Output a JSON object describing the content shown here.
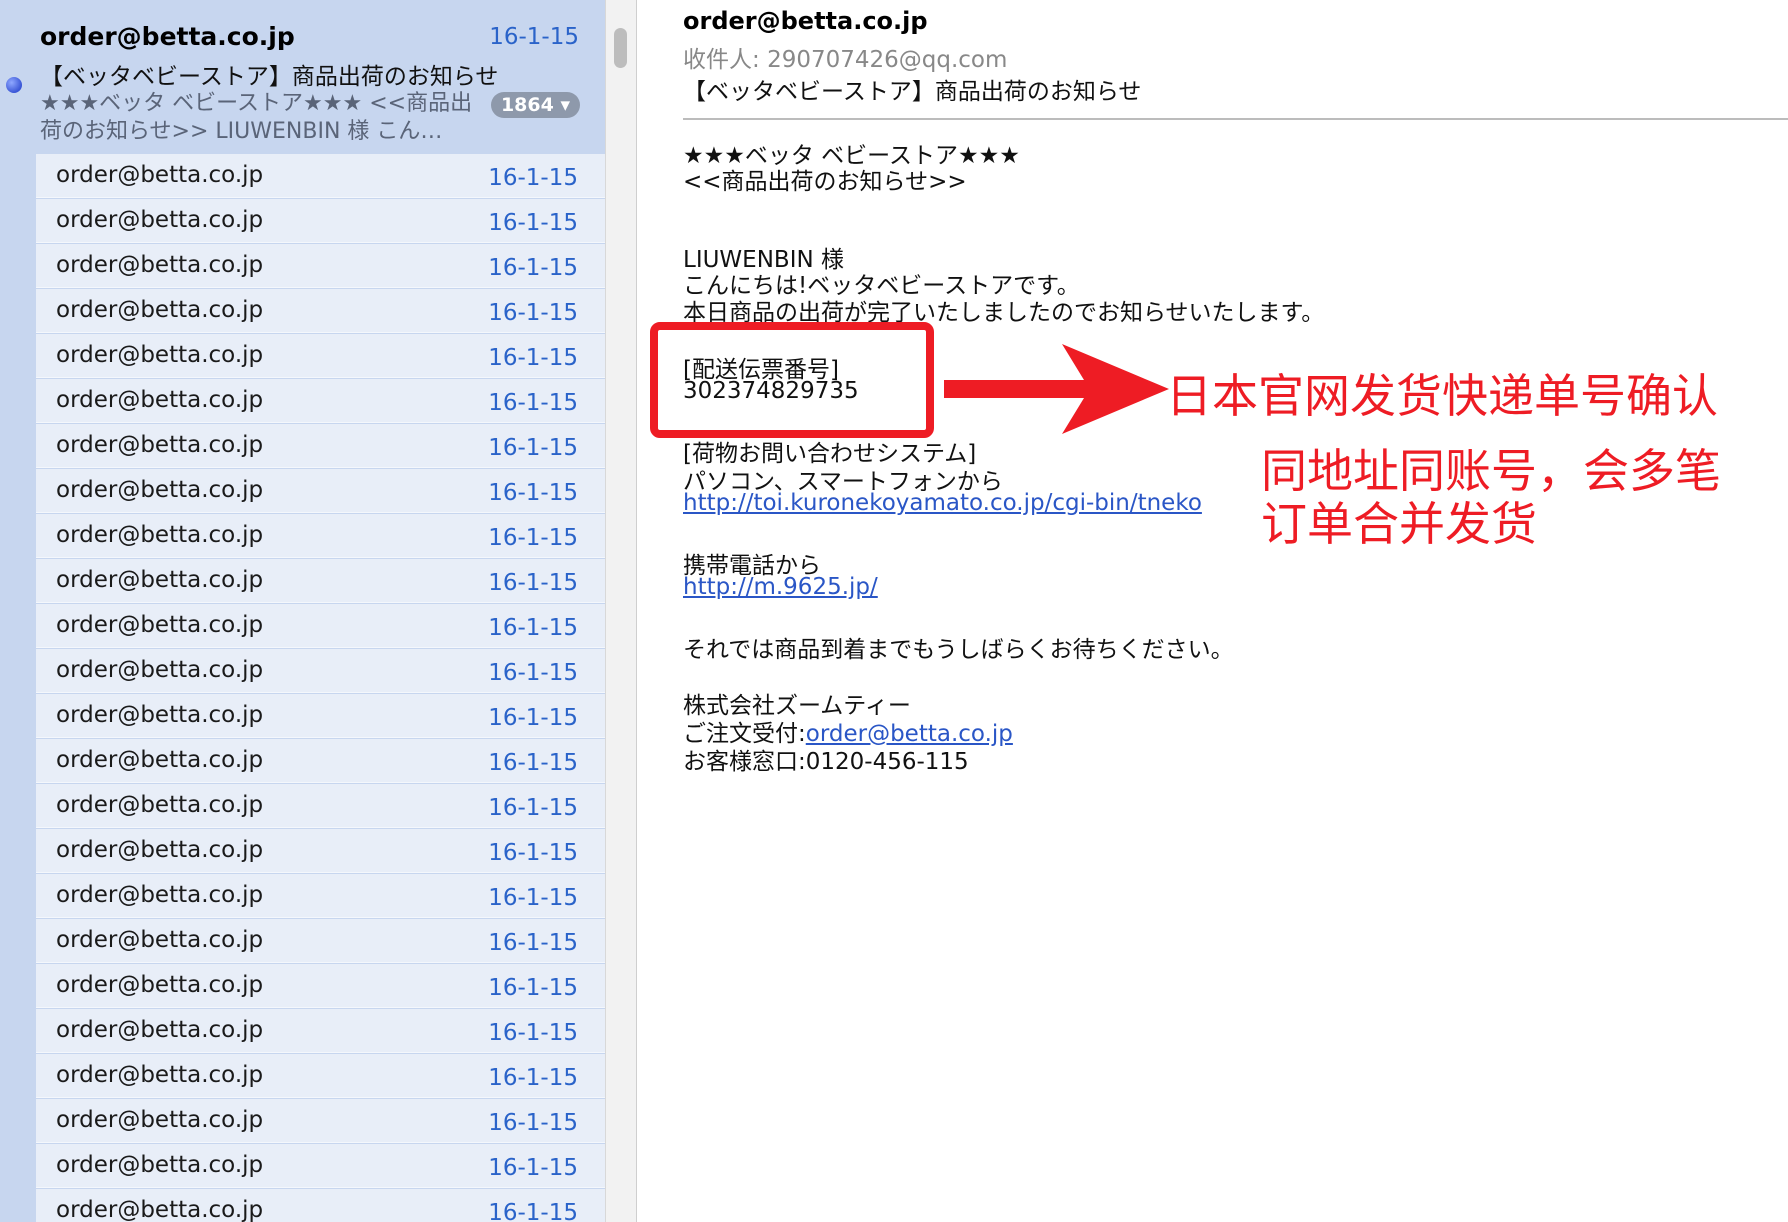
{
  "thread": {
    "sender": "order@betta.co.jp",
    "date": "16-1-15",
    "subject": "【ベッタベビーストア】商品出荷のお知らせ",
    "preview": "★★★ベッタ ベビーストア★★★ <<商品出荷のお知らせ>> LIUWENBIN 様 こん…",
    "count": "1864",
    "count_chevron": "▾"
  },
  "rows": [
    {
      "sender": "order@betta.co.jp",
      "date": "16-1-15"
    },
    {
      "sender": "order@betta.co.jp",
      "date": "16-1-15"
    },
    {
      "sender": "order@betta.co.jp",
      "date": "16-1-15"
    },
    {
      "sender": "order@betta.co.jp",
      "date": "16-1-15"
    },
    {
      "sender": "order@betta.co.jp",
      "date": "16-1-15"
    },
    {
      "sender": "order@betta.co.jp",
      "date": "16-1-15"
    },
    {
      "sender": "order@betta.co.jp",
      "date": "16-1-15"
    },
    {
      "sender": "order@betta.co.jp",
      "date": "16-1-15"
    },
    {
      "sender": "order@betta.co.jp",
      "date": "16-1-15"
    },
    {
      "sender": "order@betta.co.jp",
      "date": "16-1-15"
    },
    {
      "sender": "order@betta.co.jp",
      "date": "16-1-15"
    },
    {
      "sender": "order@betta.co.jp",
      "date": "16-1-15"
    },
    {
      "sender": "order@betta.co.jp",
      "date": "16-1-15"
    },
    {
      "sender": "order@betta.co.jp",
      "date": "16-1-15"
    },
    {
      "sender": "order@betta.co.jp",
      "date": "16-1-15"
    },
    {
      "sender": "order@betta.co.jp",
      "date": "16-1-15"
    },
    {
      "sender": "order@betta.co.jp",
      "date": "16-1-15"
    },
    {
      "sender": "order@betta.co.jp",
      "date": "16-1-15"
    },
    {
      "sender": "order@betta.co.jp",
      "date": "16-1-15"
    },
    {
      "sender": "order@betta.co.jp",
      "date": "16-1-15"
    },
    {
      "sender": "order@betta.co.jp",
      "date": "16-1-15"
    },
    {
      "sender": "order@betta.co.jp",
      "date": "16-1-15"
    },
    {
      "sender": "order@betta.co.jp",
      "date": "16-1-15"
    },
    {
      "sender": "order@betta.co.jp",
      "date": "16-1-15"
    }
  ],
  "message": {
    "from": "order@betta.co.jp",
    "to_label": "收件人:",
    "to": "290707426@qq.com",
    "subject": "【ベッタベビーストア】商品出荷のお知らせ",
    "store_title": "★★★ベッタ ベビーストア★★★",
    "notice_title": "<<商品出荷のお知らせ>>",
    "customer": "LIUWENBIN 様",
    "greeting": "こんにちは!ベッタベビーストアです。",
    "shipped_line": "本日商品の出荷が完了いたしましたのでお知らせいたします。",
    "tracking_label": "[配送伝票番号]",
    "tracking_number": "302374829735",
    "inquiry_label": "[荷物お問い合わせシステム]",
    "pc_label": "パソコン、スマートフォンから",
    "pc_url": "http://toi.kuronekoyamato.co.jp/cgi-bin/tneko",
    "mobile_label": "携帯電話から",
    "mobile_url": "http://m.9625.jp/",
    "closing": "それでは商品到着までもうしばらくお待ちください。",
    "company": "株式会社ズームティー",
    "order_label": "ご注文受付:",
    "order_email": "order@betta.co.jp",
    "support": "お客様窓口:0120-456-115"
  },
  "annotation": {
    "note1": "日本官网发货快递单号确认",
    "note2_line1": "同地址同账号，会多笔",
    "note2_line2": "订单合并发货",
    "color": "#ee1c24"
  }
}
